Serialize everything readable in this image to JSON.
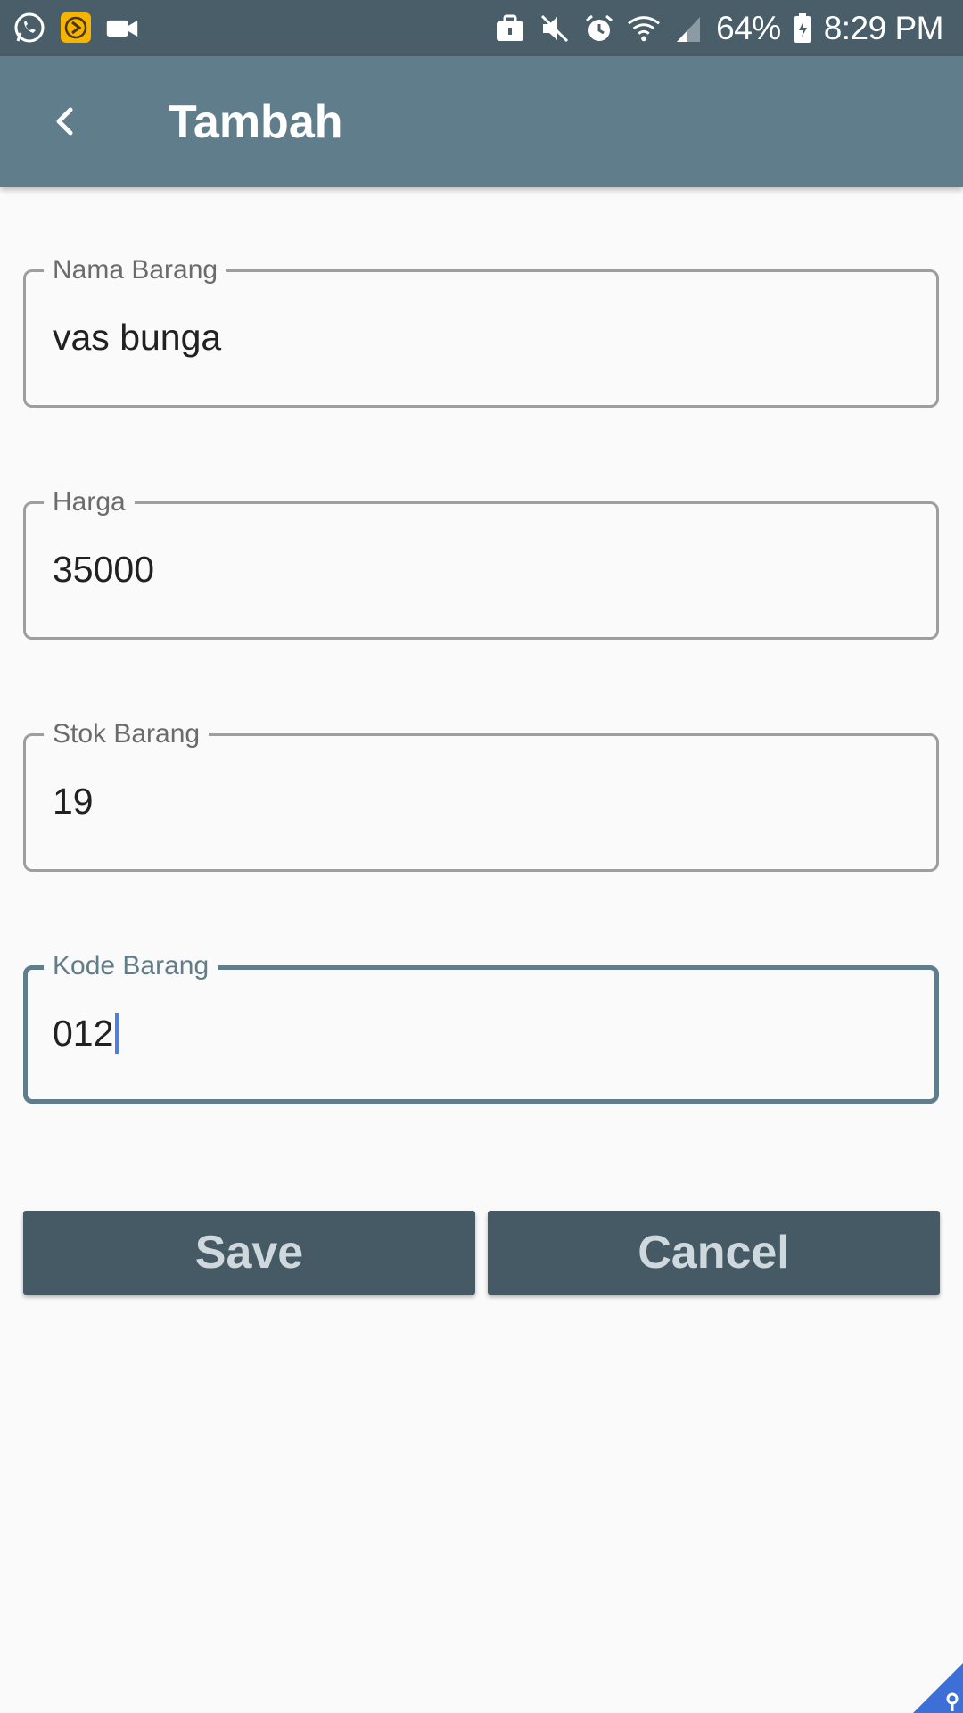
{
  "statusbar": {
    "battery": "64%",
    "time": "8:29 PM",
    "icons_left": [
      "whatsapp-icon",
      "app-notification-icon",
      "video-camera-icon"
    ],
    "icons_right": [
      "briefcase-icon",
      "mute-icon",
      "alarm-icon",
      "wifi-icon",
      "signal-icon",
      "battery-icon"
    ]
  },
  "appbar": {
    "title": "Tambah",
    "back_icon": "chevron-left-icon"
  },
  "form": {
    "nama_barang": {
      "label": "Nama Barang",
      "value": "vas bunga"
    },
    "harga": {
      "label": "Harga",
      "value": "35000"
    },
    "stok_barang": {
      "label": "Stok Barang",
      "value": "19"
    },
    "kode_barang": {
      "label": "Kode Barang",
      "value": "012"
    }
  },
  "buttons": {
    "save": "Save",
    "cancel": "Cancel"
  },
  "colors": {
    "statusbar": "#4a5e69",
    "appbar": "#607d8b",
    "button": "#455a64",
    "button_text": "#cfd8dc",
    "caret": "#4c7fe0",
    "focus_border": "#607d8b"
  }
}
